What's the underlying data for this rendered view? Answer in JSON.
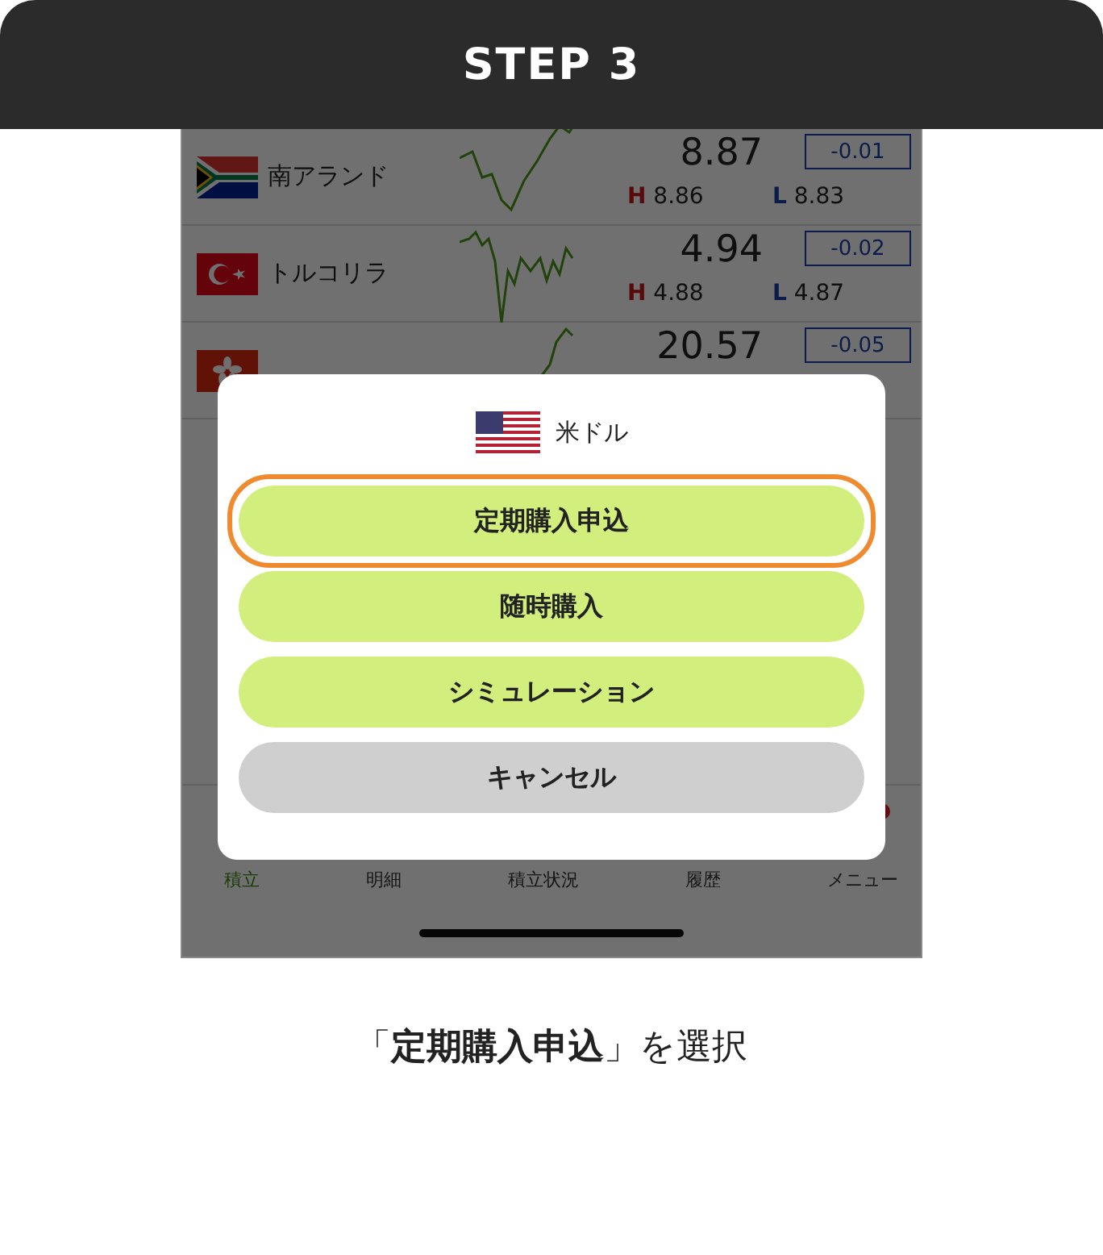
{
  "header": {
    "title": "STEP 3"
  },
  "rates": [
    {
      "flag": {
        "kind": "za"
      },
      "currency": "南アランド",
      "price": "8.87",
      "high_label": "H",
      "high": "8.86",
      "low_label": "L",
      "low": "8.83",
      "change": "-0.01"
    },
    {
      "flag": {
        "kind": "tr"
      },
      "currency": "トルコリラ",
      "price": "4.94",
      "high_label": "H",
      "high": "4.88",
      "low_label": "L",
      "low": "4.87",
      "change": "-0.02"
    },
    {
      "flag": {
        "kind": "hk"
      },
      "price": "20.57",
      "change": "-0.05"
    }
  ],
  "tab_bar": [
    {
      "label": "積立",
      "selected": true
    },
    {
      "label": "明細",
      "selected": false
    },
    {
      "label": "積立状況",
      "selected": false
    },
    {
      "label": "履歴",
      "selected": false
    },
    {
      "label": "メニュー",
      "selected": false
    }
  ],
  "dialog": {
    "flag": {
      "kind": "us"
    },
    "currency": "米ドル",
    "actions": [
      {
        "label": "定期購入申込",
        "kind": "primary",
        "highlighted": true
      },
      {
        "label": "随時購入",
        "kind": "primary",
        "highlighted": false
      },
      {
        "label": "シミュレーション",
        "kind": "primary",
        "highlighted": false
      },
      {
        "label": "キャンセル",
        "kind": "cancel",
        "highlighted": false
      }
    ]
  },
  "caption": "「**定期購入申込**」を選択"
}
